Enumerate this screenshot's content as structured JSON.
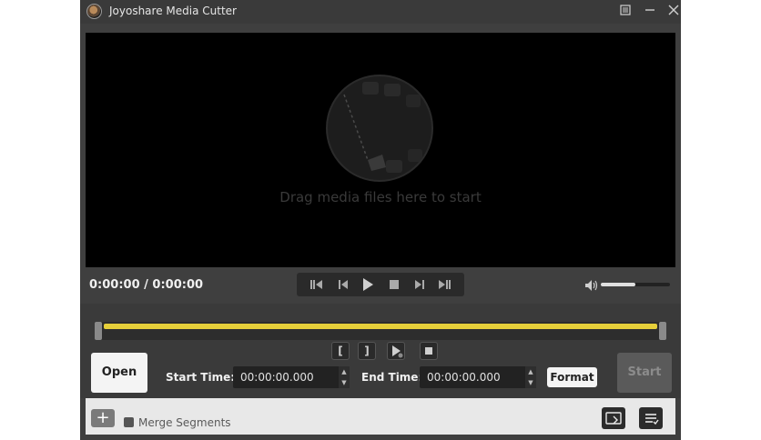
{
  "app": {
    "title": "Joyoshare Media Cutter"
  },
  "preview": {
    "drop_text": "Drag media files here to start"
  },
  "playback": {
    "time": "0:00:00 / 0:00:00",
    "volume_level": 0.5
  },
  "trim": {
    "open_label": "Open",
    "start_time_label": "Start Time:",
    "start_time_value": "00:00:00.000",
    "end_time_label": "End Time:",
    "end_time_value": "00:00:00.000",
    "format_label": "Format",
    "start_label": "Start"
  },
  "bottom": {
    "merge_label": "Merge Segments"
  },
  "colors": {
    "accent": "#e6cf3a",
    "background": "#3f3f3f"
  }
}
